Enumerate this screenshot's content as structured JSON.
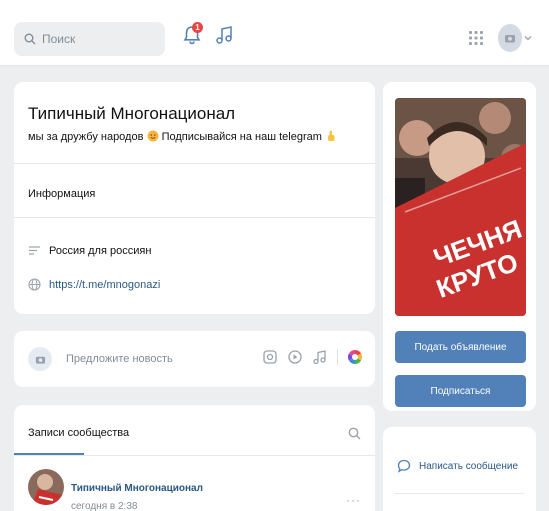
{
  "topbar": {
    "search_placeholder": "Поиск",
    "notifications_count": "1"
  },
  "community": {
    "name": "Типичный Многонационал",
    "status_part1": "мы за дружбу народов",
    "status_part2": "Подписывайся на наш telegram",
    "info_label": "Информация",
    "description": "Россия для россиян",
    "link": "https://t.me/mnogonazi"
  },
  "post_box": {
    "placeholder": "Предложите новость"
  },
  "wall": {
    "tab_label": "Записи сообщества",
    "entry_author": "Типичный Многонационал",
    "entry_time": "сегодня в 2:38",
    "entry_more": "···"
  },
  "cover": {
    "banner_line1": "ЧЕЧНЯ",
    "banner_line2": "КРУТО"
  },
  "side": {
    "ad_button": "Подать объявление",
    "subscribe_button": "Подписаться",
    "message_link": "Написать сообщение"
  },
  "colors": {
    "accent": "#5181b8",
    "link": "#2a5885",
    "badge": "#e64646",
    "background": "#edeef0"
  }
}
